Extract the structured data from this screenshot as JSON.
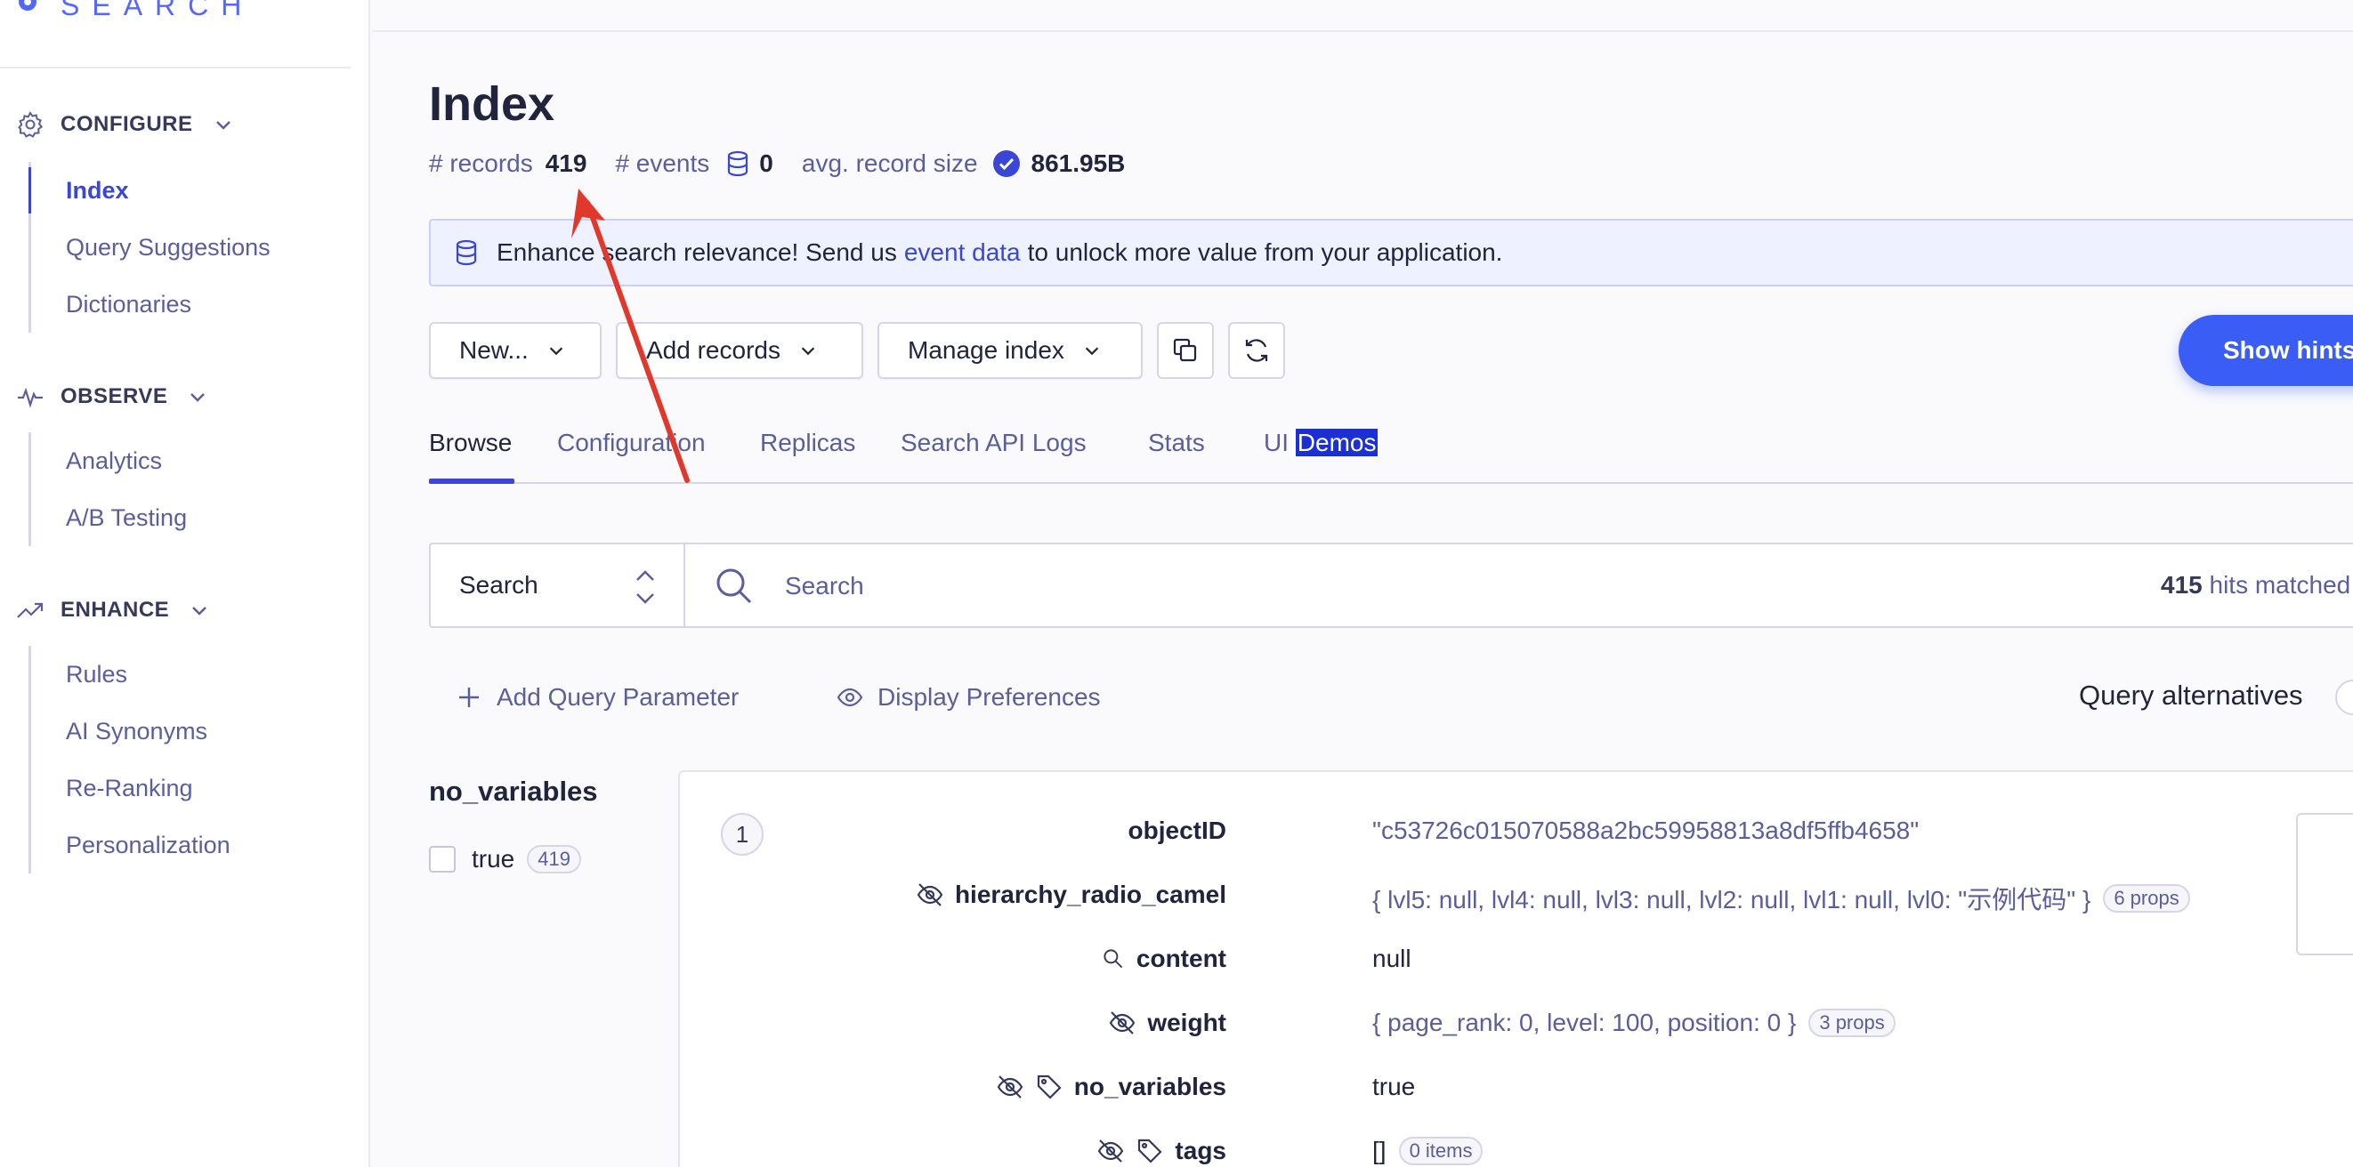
{
  "logo": {
    "text": "SEARCH"
  },
  "sidebar": {
    "configure": {
      "label": "CONFIGURE",
      "items": [
        {
          "label": "Index",
          "active": true
        },
        {
          "label": "Query Suggestions"
        },
        {
          "label": "Dictionaries"
        }
      ]
    },
    "observe": {
      "label": "OBSERVE",
      "items": [
        {
          "label": "Analytics"
        },
        {
          "label": "A/B Testing"
        }
      ]
    },
    "enhance": {
      "label": "ENHANCE",
      "items": [
        {
          "label": "Rules"
        },
        {
          "label": "AI Synonyms"
        },
        {
          "label": "Re-Ranking"
        },
        {
          "label": "Personalization"
        }
      ]
    }
  },
  "page": {
    "title": "Index",
    "records_label": "# records",
    "records_value": "419",
    "events_label": "# events",
    "events_value": "0",
    "avg_size_label": "avg. record size",
    "avg_size_value": "861.95B"
  },
  "banner": {
    "prefix": "Enhance search relevance! Send us",
    "link": "event data",
    "suffix": "to unlock more value from your application."
  },
  "toolbar": {
    "new_label": "New...",
    "add_records_label": "Add records",
    "manage_index_label": "Manage index",
    "show_hints_label": "Show hints"
  },
  "tabs": {
    "browse": "Browse",
    "configuration": "Configuration",
    "replicas": "Replicas",
    "search_api_logs": "Search API Logs",
    "stats": "Stats",
    "ui_demos_prefix": "UI",
    "ui_demos_highlight": "Demos"
  },
  "search": {
    "mode": "Search",
    "placeholder": "Search",
    "hits_count": "415",
    "hits_suffix": "hits matched"
  },
  "query_params": {
    "add_label": "Add Query Parameter",
    "display_label": "Display Preferences",
    "alternatives_label": "Query alternatives"
  },
  "facet": {
    "title": "no_variables",
    "items": [
      {
        "label": "true",
        "count": "419"
      }
    ]
  },
  "record": {
    "number": "1",
    "attributes": [
      {
        "key": "objectID",
        "value": "\"c53726c015070588a2bc59958813a8df5ffb4658\""
      },
      {
        "key": "hierarchy_radio_camel",
        "value": "{ lvl5: null, lvl4: null, lvl3: null, lvl2: null, lvl1: null, lvl0: \"示例代码\" }",
        "pill": "6 props"
      },
      {
        "key": "content",
        "value": "null"
      },
      {
        "key": "weight",
        "value": "{ page_rank: 0, level: 100, position: 0 }",
        "pill": "3 props"
      },
      {
        "key": "no_variables",
        "value": "true"
      },
      {
        "key": "tags",
        "value": "[]",
        "pill": "0 items"
      }
    ]
  },
  "colors": {
    "accent": "#3a46d6",
    "brand": "#5468ff",
    "button": "#3a5df5",
    "annotation": "#e0392b"
  }
}
